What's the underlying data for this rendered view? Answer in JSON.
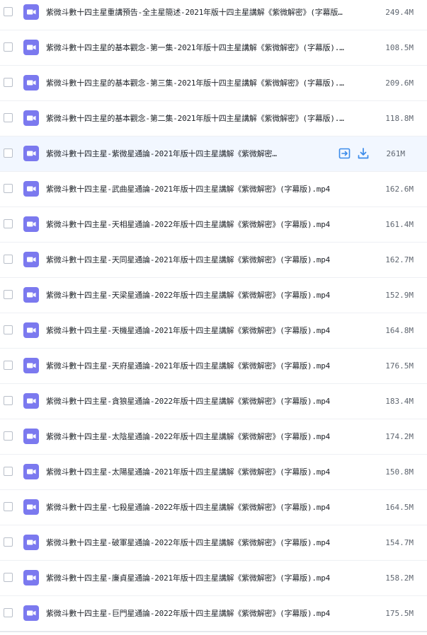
{
  "colors": {
    "icon_bg": "#7b79ef",
    "hover_bg": "#f2f7ff",
    "action_blue": "#3b8bea"
  },
  "actions": {
    "share_icon": "share-icon",
    "download_icon": "download-icon"
  },
  "files": [
    {
      "name": "紫微斗數十四主星重講預告-全主星簡述-2021年版十四主星講解《紫微解密》(字幕版…",
      "size": "249.4M"
    },
    {
      "name": "紫微斗數十四主星的基本觀念-第一集-2021年版十四主星講解《紫微解密》(字幕版).…",
      "size": "108.5M"
    },
    {
      "name": "紫微斗數十四主星的基本觀念-第三集-2021年版十四主星講解《紫微解密》(字幕版).…",
      "size": "209.6M"
    },
    {
      "name": "紫微斗數十四主星的基本觀念-第二集-2021年版十四主星講解《紫微解密》(字幕版).…",
      "size": "118.8M"
    },
    {
      "name": "紫微斗數十四主星-紫微星通論-2021年版十四主星講解《紫微解密…",
      "size": "261M"
    },
    {
      "name": "紫微斗數十四主星-武曲星通論-2021年版十四主星講解《紫微解密》(字幕版).mp4",
      "size": "162.6M"
    },
    {
      "name": "紫微斗數十四主星-天相星通論-2022年版十四主星講解《紫微解密》(字幕版).mp4",
      "size": "161.4M"
    },
    {
      "name": "紫微斗數十四主星-天同星通論-2021年版十四主星講解《紫微解密》(字幕版).mp4",
      "size": "162.7M"
    },
    {
      "name": "紫微斗數十四主星-天梁星通論-2022年版十四主星講解《紫微解密》(字幕版).mp4",
      "size": "152.9M"
    },
    {
      "name": "紫微斗數十四主星-天機星通論-2021年版十四主星講解《紫微解密》(字幕版).mp4",
      "size": "164.8M"
    },
    {
      "name": "紫微斗數十四主星-天府星通論-2021年版十四主星講解《紫微解密》(字幕版).mp4",
      "size": "176.5M"
    },
    {
      "name": "紫微斗數十四主星-貪狼星通論-2022年版十四主星講解《紫微解密》(字幕版).mp4",
      "size": "183.4M"
    },
    {
      "name": "紫微斗數十四主星-太陰星通論-2022年版十四主星講解《紫微解密》(字幕版).mp4",
      "size": "174.2M"
    },
    {
      "name": "紫微斗數十四主星-太陽星通論-2021年版十四主星講解《紫微解密》(字幕版).mp4",
      "size": "150.8M"
    },
    {
      "name": "紫微斗數十四主星-七殺星通論-2022年版十四主星講解《紫微解密》(字幕版).mp4",
      "size": "164.5M"
    },
    {
      "name": "紫微斗數十四主星-破軍星通論-2022年版十四主星講解《紫微解密》(字幕版).mp4",
      "size": "154.7M"
    },
    {
      "name": "紫微斗數十四主星-廉貞星通論-2021年版十四主星講解《紫微解密》(字幕版).mp4",
      "size": "158.2M"
    },
    {
      "name": "紫微斗數十四主星-巨門星通論-2022年版十四主星講解《紫微解密》(字幕版).mp4",
      "size": "175.5M"
    }
  ],
  "hovered_index": 4
}
